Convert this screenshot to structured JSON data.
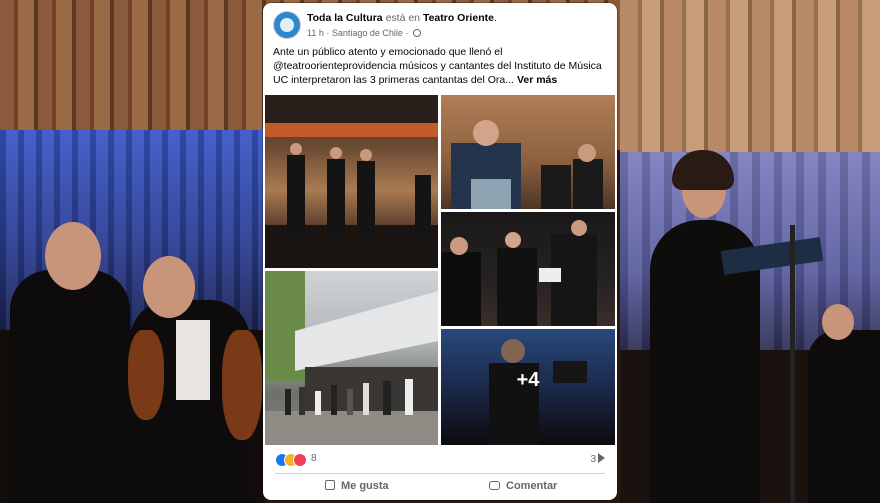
{
  "post": {
    "page_name": "Toda la Cultura",
    "connector": "está en",
    "place": "Teatro Oriente",
    "period": ".",
    "time": "11 h",
    "location": "Santiago de Chile",
    "text": "Ante un público atento y emocionado que llenó el @teatroorienteprovidencia músicos y cantantes del Instituto de Música UC interpretaron las 3 primeras cantantas del Ora...",
    "see_more": "Ver más",
    "extra_photos": "+4",
    "reactions_count": "8",
    "shares_count": "3",
    "icons": [
      "globe-icon",
      "like-reaction-icon",
      "care-reaction-icon",
      "love-reaction-icon",
      "share-icon",
      "like-icon",
      "comment-icon"
    ]
  },
  "actions": {
    "like": "Me gusta",
    "comment": "Comentar"
  },
  "colors": {
    "facebook_blue": "#1877f2",
    "secondary_text": "#65676b",
    "love_red": "#f33e58",
    "care_yellow": "#f7b125"
  }
}
